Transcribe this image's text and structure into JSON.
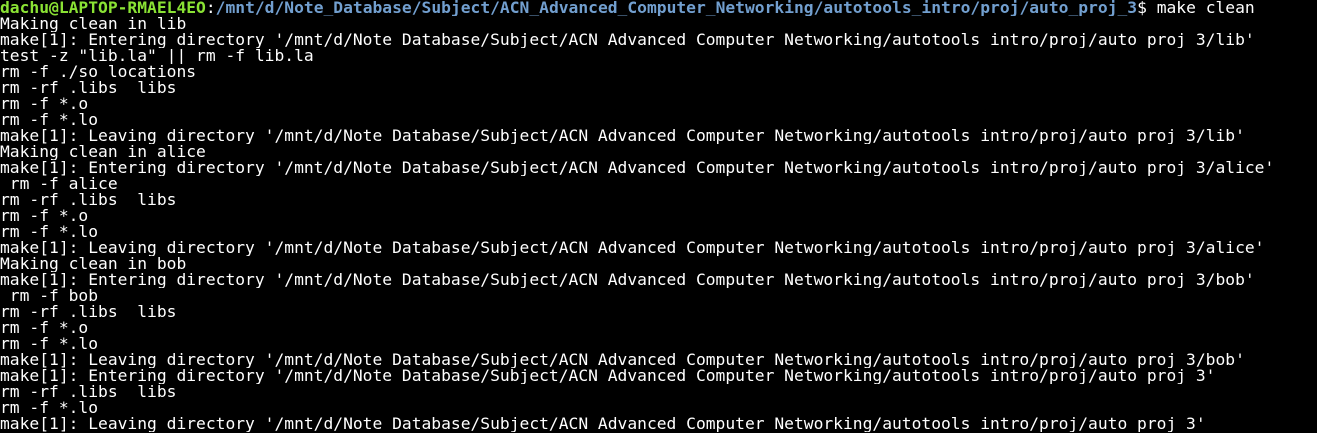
{
  "terminal": {
    "prompt": {
      "user_host": "dachu@LAPTOP-RMAEL4EO",
      "colon": ":",
      "path": "/mnt/d/Note_Database/Subject/ACN_Advanced_Computer_Networking/autotools_intro/proj/auto_proj_3",
      "symbol": "$ ",
      "command": "make clean"
    },
    "colors": {
      "background": "#000000",
      "foreground": "#ffffff",
      "user_host": "#8ae234",
      "path": "#729fcf"
    },
    "output_lines": [
      "Making clean in lib",
      "make[1]: Entering directory '/mnt/d/Note_Database/Subject/ACN_Advanced_Computer_Networking/autotools_intro/proj/auto_proj_3/lib'",
      "test -z \"lib.la\" || rm -f lib.la",
      "rm -f ./so_locations",
      "rm -rf .libs _libs",
      "rm -f *.o",
      "rm -f *.lo",
      "make[1]: Leaving directory '/mnt/d/Note_Database/Subject/ACN_Advanced_Computer_Networking/autotools_intro/proj/auto_proj_3/lib'",
      "Making clean in alice",
      "make[1]: Entering directory '/mnt/d/Note_Database/Subject/ACN_Advanced_Computer_Networking/autotools_intro/proj/auto_proj_3/alice'",
      " rm -f alice",
      "rm -rf .libs _libs",
      "rm -f *.o",
      "rm -f *.lo",
      "make[1]: Leaving directory '/mnt/d/Note_Database/Subject/ACN_Advanced_Computer_Networking/autotools_intro/proj/auto_proj_3/alice'",
      "Making clean in bob",
      "make[1]: Entering directory '/mnt/d/Note_Database/Subject/ACN_Advanced_Computer_Networking/autotools_intro/proj/auto_proj_3/bob'",
      " rm -f bob",
      "rm -rf .libs _libs",
      "rm -f *.o",
      "rm -f *.lo",
      "make[1]: Leaving directory '/mnt/d/Note_Database/Subject/ACN_Advanced_Computer_Networking/autotools_intro/proj/auto_proj_3/bob'",
      "make[1]: Entering directory '/mnt/d/Note_Database/Subject/ACN_Advanced_Computer_Networking/autotools_intro/proj/auto_proj_3'",
      "rm -rf .libs _libs",
      "rm -f *.lo",
      "make[1]: Leaving directory '/mnt/d/Note_Database/Subject/ACN_Advanced_Computer_Networking/autotools_intro/proj/auto_proj_3'"
    ]
  }
}
